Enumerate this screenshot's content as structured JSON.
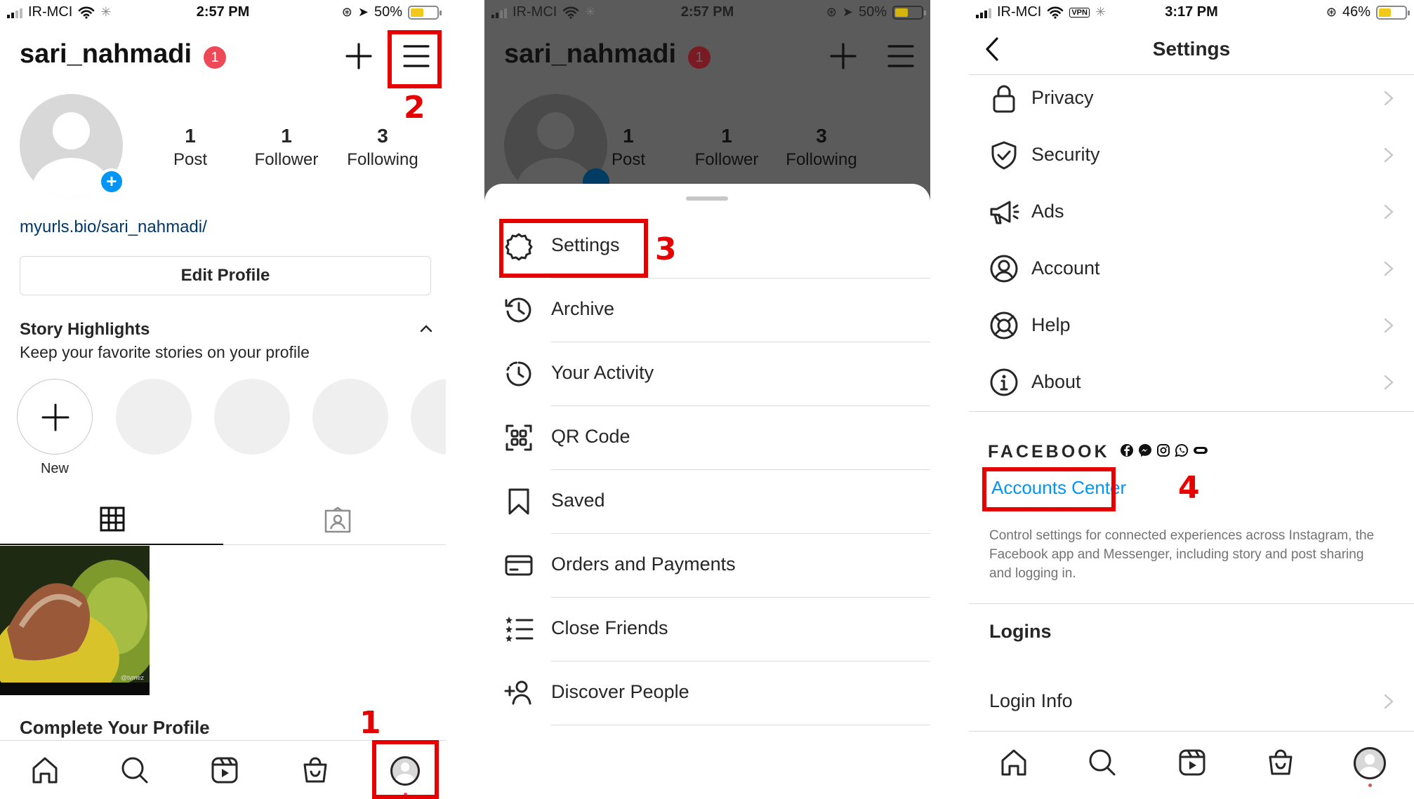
{
  "panel1": {
    "status": {
      "carrier": "IR-MCI",
      "time": "2:57 PM",
      "battery": "50%"
    },
    "username": "sari_nahmadi",
    "notif_badge": "1",
    "stats": [
      {
        "value": "1",
        "label": "Post"
      },
      {
        "value": "1",
        "label": "Follower"
      },
      {
        "value": "3",
        "label": "Following"
      }
    ],
    "link": "myurls.bio/sari_nahmadi/",
    "edit_profile": "Edit Profile",
    "highlights_title": "Story Highlights",
    "highlights_sub": "Keep your favorite stories on your profile",
    "new_label": "New",
    "photo_watermark": "@tvmez",
    "complete_profile": "Complete Your Profile",
    "step1": "1",
    "step2": "2"
  },
  "panel2": {
    "status": {
      "carrier": "IR-MCI",
      "time": "2:57 PM",
      "battery": "50%"
    },
    "username": "sari_nahmadi",
    "notif_badge": "1",
    "stats": [
      {
        "value": "1",
        "label": "Post"
      },
      {
        "value": "1",
        "label": "Follower"
      },
      {
        "value": "3",
        "label": "Following"
      }
    ],
    "menu": [
      {
        "label": "Settings",
        "icon": "settings-icon"
      },
      {
        "label": "Archive",
        "icon": "archive-icon"
      },
      {
        "label": "Your Activity",
        "icon": "activity-icon"
      },
      {
        "label": "QR Code",
        "icon": "qr-code-icon"
      },
      {
        "label": "Saved",
        "icon": "bookmark-icon"
      },
      {
        "label": "Orders and Payments",
        "icon": "card-icon"
      },
      {
        "label": "Close Friends",
        "icon": "close-friends-icon"
      },
      {
        "label": "Discover People",
        "icon": "add-person-icon"
      }
    ],
    "step3": "3"
  },
  "panel3": {
    "status": {
      "carrier": "IR-MCI",
      "vpn": "VPN",
      "time": "3:17 PM",
      "battery": "46%"
    },
    "title": "Settings",
    "items": [
      {
        "label": "Privacy",
        "icon": "lock-icon"
      },
      {
        "label": "Security",
        "icon": "shield-icon"
      },
      {
        "label": "Ads",
        "icon": "megaphone-icon"
      },
      {
        "label": "Account",
        "icon": "account-icon"
      },
      {
        "label": "Help",
        "icon": "lifebuoy-icon"
      },
      {
        "label": "About",
        "icon": "info-icon"
      }
    ],
    "facebook": "FACEBOOK",
    "accounts_center": "Accounts Center",
    "ac_desc": "Control settings for connected experiences across Instagram, the Facebook app and Messenger, including story and post sharing and logging in.",
    "logins": "Logins",
    "login_info": "Login Info",
    "step4": "4"
  },
  "colors": {
    "accent": "#e60000",
    "link": "#0095f6",
    "linkDark": "#00376b",
    "badge": "#ed4956"
  }
}
